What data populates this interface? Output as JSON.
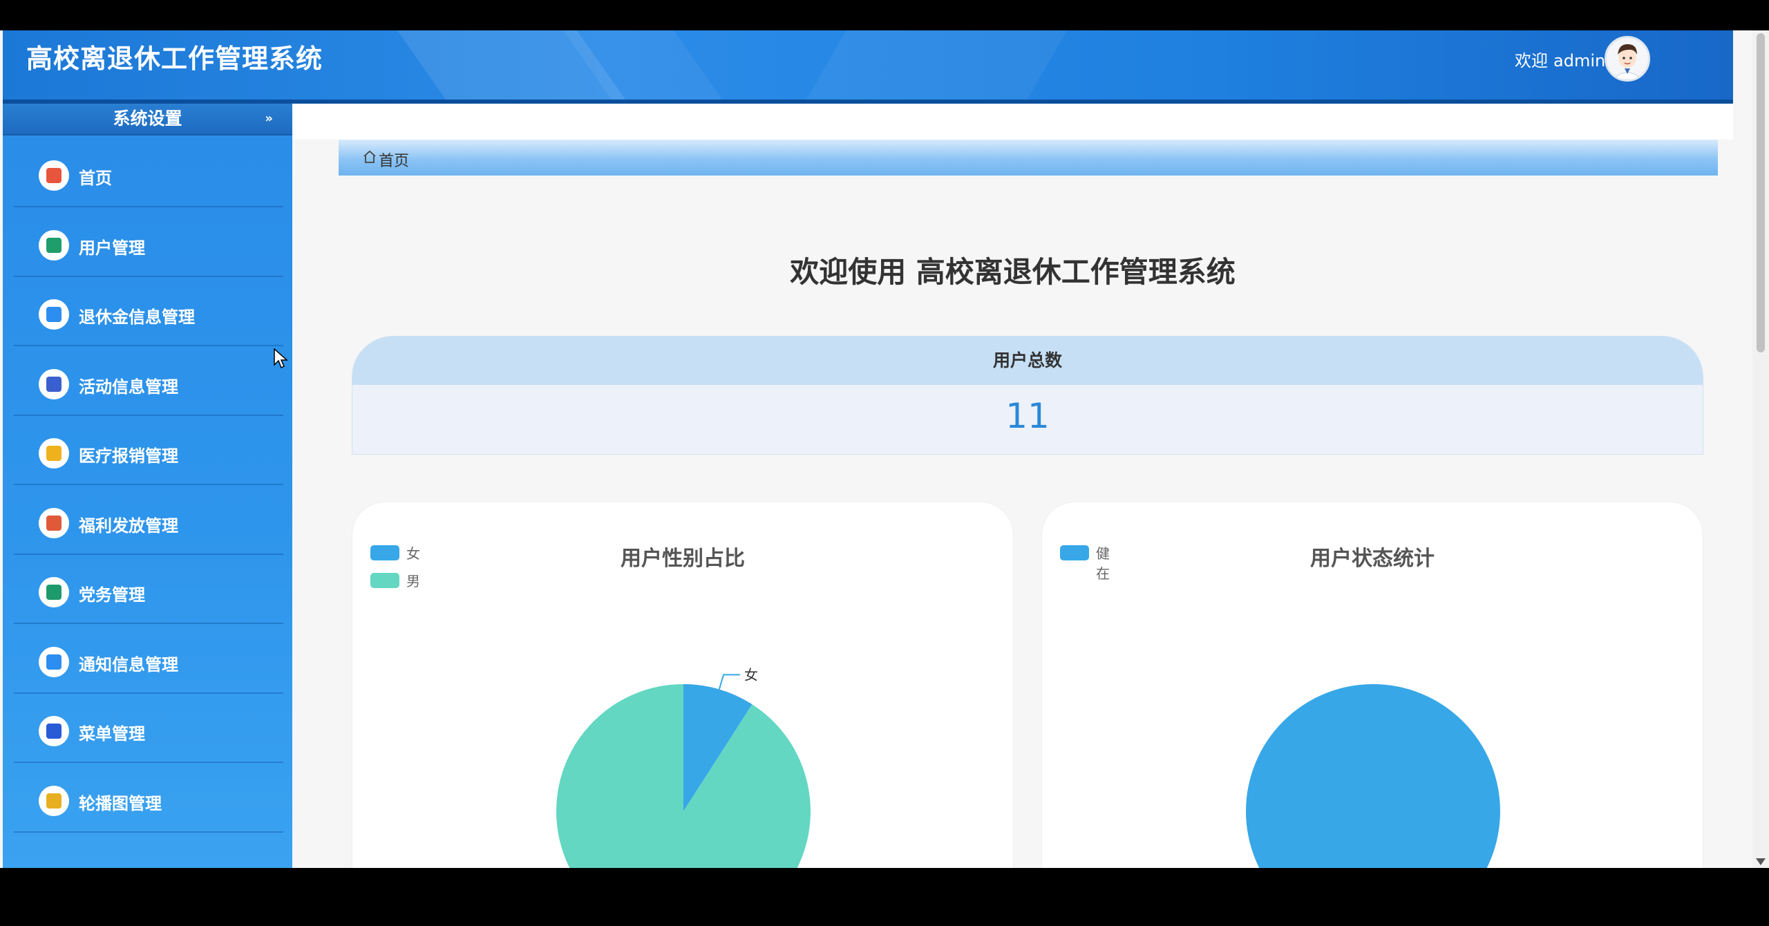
{
  "header": {
    "title": "高校离退休工作管理系统",
    "welcome_prefix": "欢迎",
    "username": "admin"
  },
  "sidebar": {
    "section_title": "系统设置",
    "items": [
      {
        "label": "首页",
        "icon": "home-icon",
        "color": "#e8553d"
      },
      {
        "label": "用户管理",
        "icon": "user-badge-icon",
        "color": "#1f9d6b"
      },
      {
        "label": "退休金信息管理",
        "icon": "pension-icon",
        "color": "#2b8ef0"
      },
      {
        "label": "活动信息管理",
        "icon": "briefcase-icon",
        "color": "#3a5fd0"
      },
      {
        "label": "医疗报销管理",
        "icon": "medical-ticket-icon",
        "color": "#f0b21c"
      },
      {
        "label": "福利发放管理",
        "icon": "bookmark-icon",
        "color": "#e05a3a"
      },
      {
        "label": "党务管理",
        "icon": "calendar-icon",
        "color": "#1d9a6c"
      },
      {
        "label": "通知信息管理",
        "icon": "grid-icon",
        "color": "#2b8ef0"
      },
      {
        "label": "菜单管理",
        "icon": "square-icon",
        "color": "#2a5bd7"
      },
      {
        "label": "轮播图管理",
        "icon": "image-icon",
        "color": "#e8b020"
      }
    ]
  },
  "breadcrumb": {
    "home": "首页"
  },
  "main": {
    "welcome_heading": "欢迎使用 高校离退休工作管理系统",
    "stat": {
      "label": "用户总数",
      "value": "11"
    }
  },
  "chart_data": [
    {
      "type": "pie",
      "title": "用户性别占比",
      "legend_position": "top-left",
      "categories": [
        "女",
        "男"
      ],
      "values": [
        1,
        10
      ],
      "colors": [
        "#37a7e8",
        "#63d7c2"
      ],
      "slice_labels": [
        "女"
      ]
    },
    {
      "type": "pie",
      "title": "用户状态统计",
      "legend_position": "top-left",
      "categories": [
        "健在"
      ],
      "values": [
        11
      ],
      "colors": [
        "#37a7e8"
      ]
    }
  ]
}
